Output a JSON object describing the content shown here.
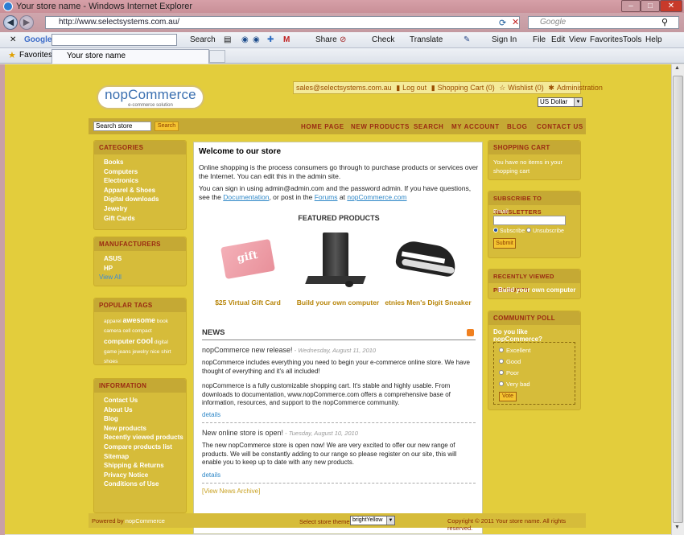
{
  "window": {
    "title": "Your store name - Windows Internet Explorer"
  },
  "browser": {
    "address": "http://www.selectsystems.com.au/",
    "search_placeholder": "Google",
    "tab_title": "Your store name",
    "favorites_label": "Favorites",
    "toolbar": {
      "google_label": "Google",
      "search_label": "Search",
      "share_label": "Share",
      "check_label": "Check",
      "translate_label": "Translate",
      "signin_label": "Sign In",
      "menus": [
        "File",
        "Edit",
        "View",
        "Favorites",
        "Tools",
        "Help"
      ]
    }
  },
  "store": {
    "logo_text": "nopCommerce",
    "logo_tagline": "e-commerce solution",
    "header_links": [
      "sales@selectsystems.com.au",
      "Log out",
      "Shopping Cart (0)",
      "Wishlist (0)",
      "Administration"
    ],
    "currency": "US Dollar",
    "search_placeholder": "Search store",
    "search_button": "Search",
    "menu": [
      "HOME PAGE",
      "NEW PRODUCTS",
      "SEARCH",
      "MY ACCOUNT",
      "BLOG",
      "CONTACT US"
    ],
    "categories": {
      "title": "CATEGORIES",
      "items": [
        "Books",
        "Computers",
        "Electronics",
        "Apparel & Shoes",
        "Digital downloads",
        "Jewelry",
        "Gift Cards"
      ]
    },
    "manufacturers": {
      "title": "MANUFACTURERS",
      "items": [
        "ASUS",
        "HP"
      ],
      "view_all": "View All"
    },
    "popular_tags": {
      "title": "POPULAR TAGS",
      "tags": [
        "apparel",
        "awesome",
        "book",
        "camera",
        "cell",
        "compact",
        "computer",
        "cool",
        "digital",
        "game",
        "jeans",
        "jewelry",
        "nice",
        "shirt",
        "shoes"
      ]
    },
    "information": {
      "title": "INFORMATION",
      "items": [
        "Contact Us",
        "About Us",
        "Blog",
        "New products",
        "Recently viewed products",
        "Compare products list",
        "Sitemap",
        "Shipping & Returns",
        "Privacy Notice",
        "Conditions of Use"
      ]
    },
    "welcome": {
      "title": "Welcome to our store",
      "p1": "Online shopping is the process consumers go through to purchase products or services over the Internet. You can edit this in the admin site.",
      "p2a": "You can sign in using admin@admin.com and the password admin. If you have questions, see the",
      "p2_doc": "Documentation",
      "p2b": ", or post in the",
      "p2_forums": "Forums",
      "p2c": "at",
      "p2_site": "nopCommerce.com"
    },
    "featured": {
      "title": "FEATURED PRODUCTS",
      "products": [
        {
          "name": "$25 Virtual Gift Card",
          "image": "gift-card"
        },
        {
          "name": "Build your own computer",
          "image": "desktop-computer"
        },
        {
          "name": "etnies Men's Digit Sneaker",
          "image": "sneaker"
        }
      ]
    },
    "news": {
      "title": "NEWS",
      "items": [
        {
          "title": "nopCommerce new release!",
          "date": " - Wednesday, August 11, 2010",
          "body1": "nopCommerce includes everything you need to begin your e-commerce online store. We have thought of everything and it's all included!",
          "body2": "nopCommerce is a fully customizable shopping cart. It's stable and highly usable. From downloads to documentation, www.nopCommerce.com offers a comprehensive base of information, resources, and support to the nopCommerce community.",
          "details": "details"
        },
        {
          "title": "New online store is open!",
          "date": " - Tuesday, August 10, 2010",
          "body1": "The new nopCommerce store is open now! We are very excited to offer our new range of products. We will be constantly adding to our range so please register on our site, this will enable you to keep up to date with any new products.",
          "details": "details"
        }
      ],
      "archive": "[View News Archive]"
    },
    "cart": {
      "title": "SHOPPING CART",
      "text": "You have no items in your shopping cart"
    },
    "newsletter": {
      "title": "SUBSCRIBE TO NEWSLETTERS",
      "email_label": "Email",
      "email_value": "",
      "subscribe": "Subscribe",
      "unsubscribe": "Unsubscribe",
      "submit": "Submit"
    },
    "recent": {
      "title": "RECENTLY VIEWED PRODUCTS",
      "item": "Build your own computer"
    },
    "poll": {
      "title": "COMMUNITY POLL",
      "question": "Do you like nopCommerce?",
      "options": [
        "Excellent",
        "Good",
        "Poor",
        "Very bad"
      ],
      "vote": "Vote"
    },
    "footer": {
      "powered_label": "Powered by",
      "powered_link": "nopCommerce",
      "theme_label": "Select store theme:",
      "theme_value": "brightYellow",
      "copyright": "Copyright © 2011 Your store name. All rights reserved."
    }
  }
}
